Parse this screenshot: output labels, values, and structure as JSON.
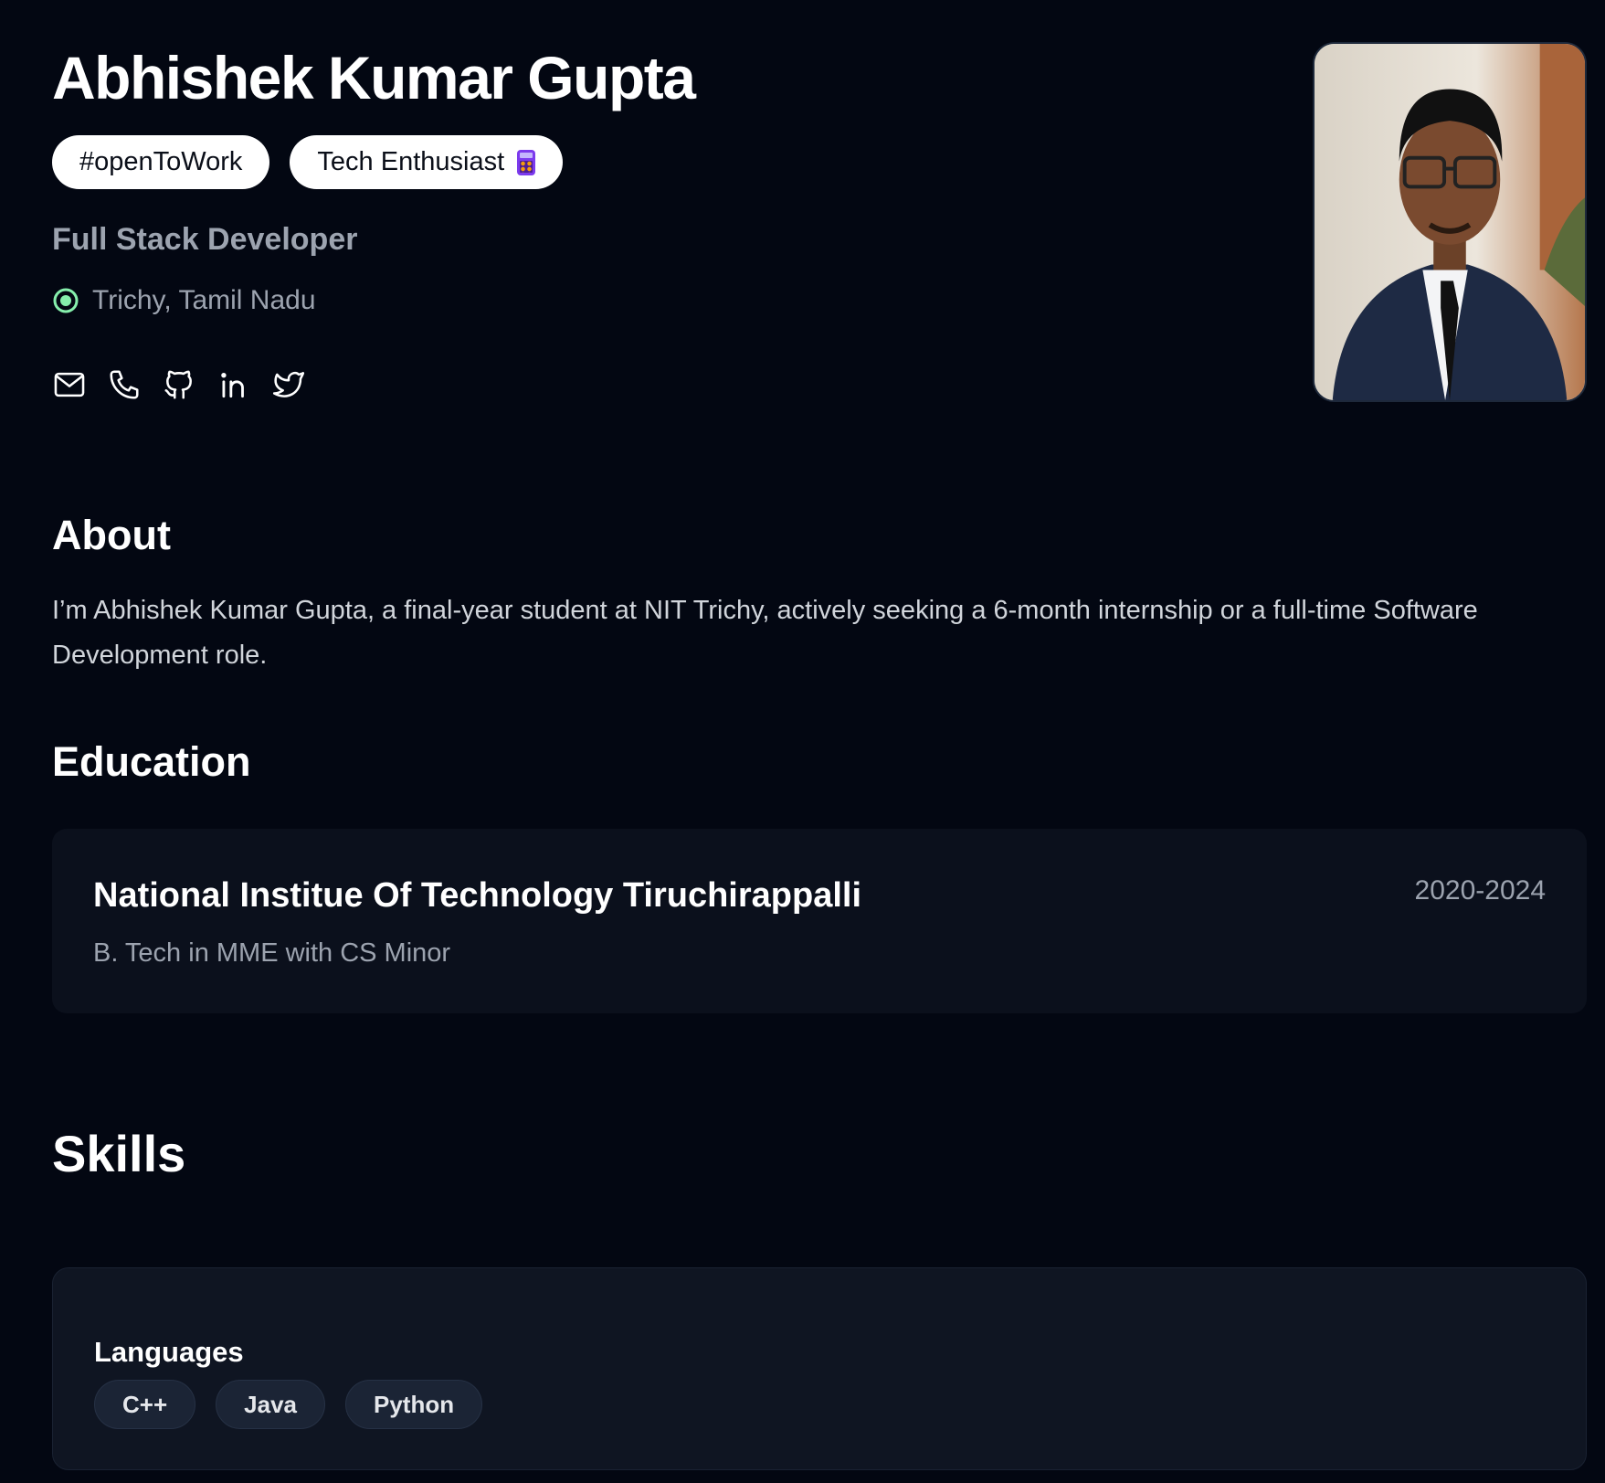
{
  "profile": {
    "name": "Abhishek Kumar Gupta",
    "badges": [
      {
        "label": "#openToWork",
        "icon": ""
      },
      {
        "label": "Tech Enthusiast",
        "icon": "calculator-emoji-icon"
      }
    ],
    "title": "Full Stack Developer",
    "location": "Trichy, Tamil Nadu",
    "location_icon_color": "#86efac",
    "socials": [
      {
        "icon": "mail-icon"
      },
      {
        "icon": "phone-icon"
      },
      {
        "icon": "github-icon"
      },
      {
        "icon": "linkedin-icon"
      },
      {
        "icon": "twitter-icon"
      }
    ]
  },
  "about": {
    "heading": "About",
    "text": "I’m Abhishek Kumar Gupta, a final-year student at NIT Trichy, actively seeking a 6-month internship or a full-time Software Development role."
  },
  "education": {
    "heading": "Education",
    "items": [
      {
        "school": "National Institue Of Technology Tiruchirappalli",
        "degree": "B. Tech in MME with CS Minor",
        "years": "2020-2024"
      }
    ]
  },
  "skills": {
    "heading": "Skills",
    "groups": [
      {
        "category": "Languages",
        "items": [
          "C++",
          "Java",
          "Python"
        ]
      }
    ]
  },
  "colors": {
    "background": "#030712",
    "card": "#0b101c",
    "muted_text": "#9ca3af",
    "badge_bg": "#ffffff"
  }
}
